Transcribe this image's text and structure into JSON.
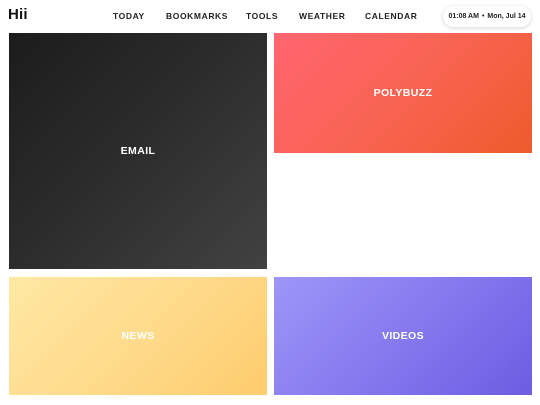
{
  "header": {
    "logo": "Hii",
    "nav": [
      {
        "label": "TODAY"
      },
      {
        "label": "BOOKMARKS"
      },
      {
        "label": "TOOLS"
      },
      {
        "label": "WEATHER"
      },
      {
        "label": "CALENDAR"
      }
    ],
    "clock": {
      "time": "01:08 AM",
      "separator": "•",
      "date": "Mon, Jul 14"
    }
  },
  "tiles": [
    {
      "label": "EMAIL",
      "colors": [
        "#1c1c1c",
        "#424242"
      ]
    },
    {
      "label": "POLYBUZZ",
      "colors": [
        "#ff6570",
        "#ee5b2b"
      ]
    },
    {
      "label": "NEWS",
      "colors": [
        "#ffe9a4",
        "#fdcc6c"
      ]
    },
    {
      "label": "VIDEOS",
      "colors": [
        "#9d96f8",
        "#6c5de2"
      ]
    }
  ]
}
